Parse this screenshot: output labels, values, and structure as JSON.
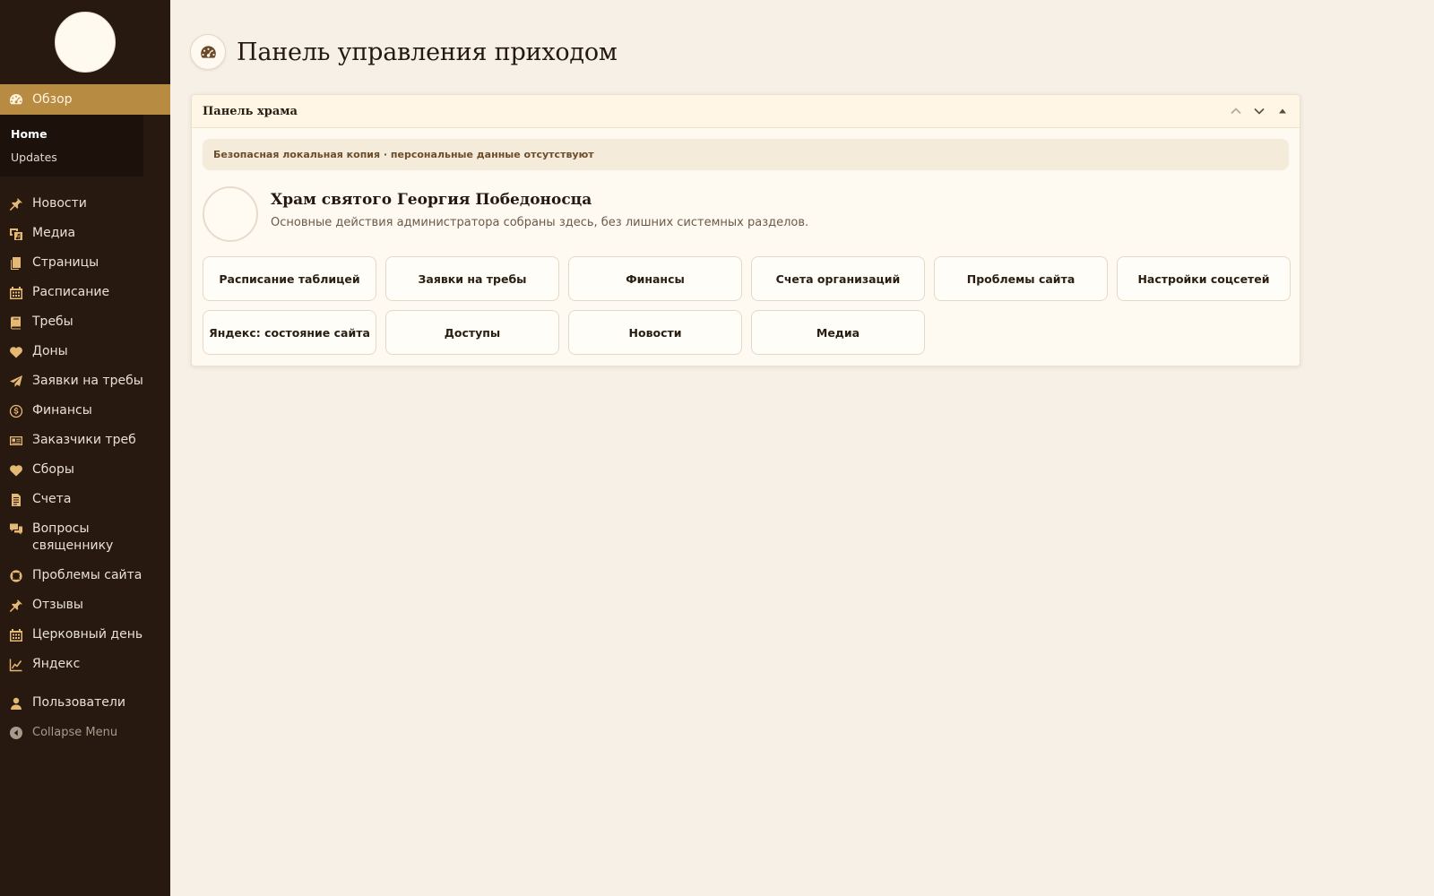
{
  "page": {
    "title": "Панель управления приходом",
    "icon": "dashboard-icon"
  },
  "sidebar": {
    "active": {
      "label": "Обзор",
      "icon": "dashboard-icon"
    },
    "submenu": [
      {
        "label": "Home",
        "current": true
      },
      {
        "label": "Updates",
        "current": false
      }
    ],
    "items": [
      {
        "label": "Новости",
        "icon": "pin-icon"
      },
      {
        "label": "Медиа",
        "icon": "media-icon"
      },
      {
        "label": "Страницы",
        "icon": "pages-icon"
      },
      {
        "label": "Расписание",
        "icon": "calendar-icon"
      },
      {
        "label": "Требы",
        "icon": "book-icon"
      },
      {
        "label": "Доны",
        "icon": "heart-icon"
      },
      {
        "label": "Заявки на требы",
        "icon": "send-icon"
      },
      {
        "label": "Финансы",
        "icon": "dollar-icon"
      },
      {
        "label": "Заказчики треб",
        "icon": "id-card-icon"
      },
      {
        "label": "Сборы",
        "icon": "heart-icon"
      },
      {
        "label": "Счета",
        "icon": "invoice-icon"
      },
      {
        "label": "Вопросы священнику",
        "icon": "chat-icon"
      },
      {
        "label": "Проблемы сайта",
        "icon": "lifebuoy-icon"
      },
      {
        "label": "Отзывы",
        "icon": "pin-icon"
      },
      {
        "label": "Церковный день",
        "icon": "calendar-icon"
      },
      {
        "label": "Яндекс",
        "icon": "chart-line-icon"
      }
    ],
    "users": {
      "label": "Пользователи",
      "icon": "user-icon"
    },
    "collapse": {
      "label": "Collapse Menu",
      "icon": "collapse-icon"
    }
  },
  "panel": {
    "title": "Панель храма",
    "notice": "Безопасная локальная копия · персональные данные отсутствуют",
    "org_name": "Храм святого Георгия Победоносца",
    "org_desc": "Основные действия администратора собраны здесь, без лишних системных разделов.",
    "buttons": [
      "Расписание таблицей",
      "Заявки на требы",
      "Финансы",
      "Счета организаций",
      "Проблемы сайта",
      "Настройки соцсетей",
      "Яндекс: состояние сайта",
      "Доступы",
      "Новости",
      "Медиа"
    ]
  },
  "colors": {
    "sidebar_bg": "#271910",
    "sidebar_active": "#b88b43",
    "page_bg": "#f6f0e6",
    "panel_bg": "#fffaf1",
    "icon_accent": "#e5b874"
  }
}
